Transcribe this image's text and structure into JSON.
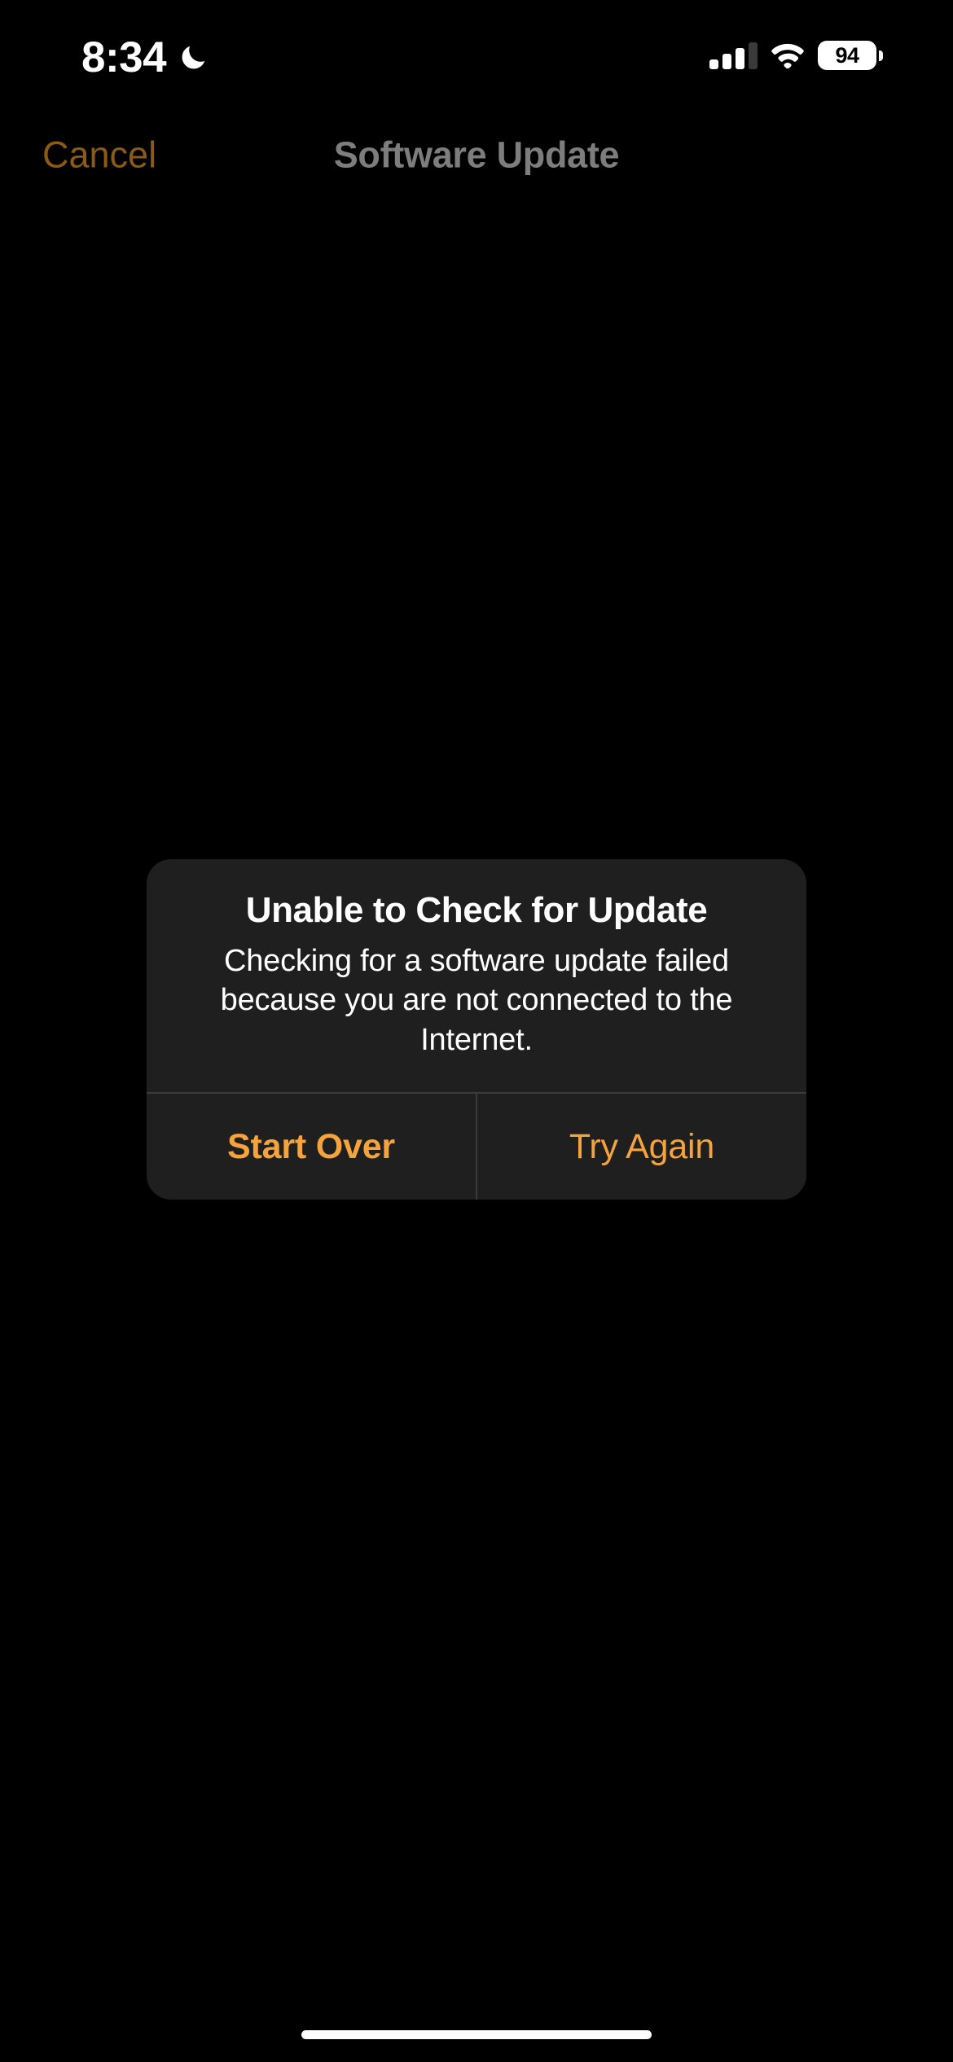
{
  "status_bar": {
    "time": "8:34",
    "focus_icon": "crescent-moon-icon",
    "cellular_icon": "cellular-signal-icon",
    "cellular_bars_filled": 3,
    "cellular_bars_total": 4,
    "wifi_icon": "wifi-icon",
    "battery_percent": "94",
    "battery_icon": "battery-icon"
  },
  "nav_bar": {
    "cancel_label": "Cancel",
    "title": "Software Update"
  },
  "alert": {
    "title": "Unable to Check for Update",
    "message": "Checking for a software update failed because you are not connected to the Internet.",
    "buttons": [
      {
        "label": "Start Over",
        "style": "primary"
      },
      {
        "label": "Try Again",
        "style": "secondary"
      }
    ]
  },
  "home_indicator": {
    "name": "home-indicator"
  },
  "colors": {
    "background": "#000000",
    "alert_background": "#1f1f1f",
    "accent_orange": "#f5a33c",
    "dimmed_orange": "#8a5a16",
    "dimmed_title_gray": "#7d7d7d",
    "divider": "#3b3b3b",
    "text_white": "#ffffff"
  }
}
